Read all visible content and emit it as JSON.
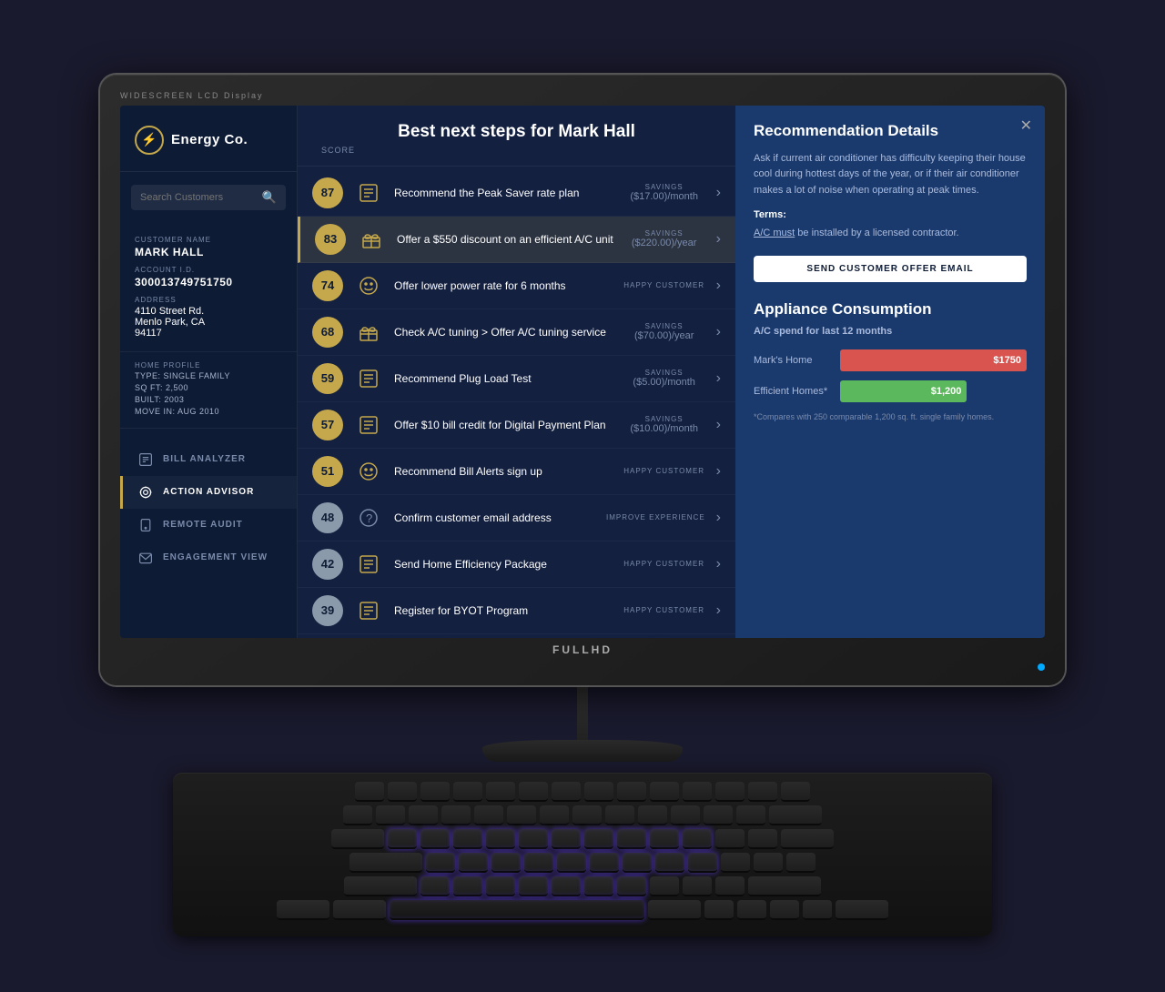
{
  "monitor": {
    "brand": "WIDESCREEN LCD Display",
    "fullhd": "FULLHD"
  },
  "app": {
    "logo": "⚡",
    "company": "Energy Co.",
    "search_placeholder": "Search Customers",
    "main_title": "Best next steps for Mark Hall",
    "score_label": "SCORE"
  },
  "customer": {
    "name_label": "CUSTOMER NAME",
    "name": "MARK HALL",
    "account_label": "ACCOUNT I.D.",
    "account": "300013749751750",
    "address_label": "ADDRESS",
    "address_line1": "4110 Street Rd.",
    "address_line2": "Menlo Park, CA",
    "address_line3": "94117",
    "profile_label": "HOME PROFILE",
    "type": "TYPE: SINGLE FAMILY",
    "sqft": "SQ FT: 2,500",
    "built": "BUILT: 2003",
    "movein": "MOVE IN: AUG 2010"
  },
  "nav": [
    {
      "id": "bill-analyzer",
      "label": "BILL ANALYZER",
      "icon": "grid"
    },
    {
      "id": "action-advisor",
      "label": "ACTION ADVISOR",
      "icon": "target",
      "active": true
    },
    {
      "id": "remote-audit",
      "label": "REMOTE AUDIT",
      "icon": "phone"
    },
    {
      "id": "engagement-view",
      "label": "ENGAGEMENT VIEW",
      "icon": "mail"
    }
  ],
  "actions": [
    {
      "score": 87,
      "text": "Recommend the Peak Saver rate plan",
      "tag_type": "savings",
      "tag_label": "SAVINGS",
      "tag_value": "($17.00)/month",
      "icon": "checklist"
    },
    {
      "score": 83,
      "text": "Offer a $550 discount on an efficient A/C unit",
      "tag_type": "savings",
      "tag_label": "SAVINGS",
      "tag_value": "($220.00)/year",
      "icon": "gift",
      "highlighted": true
    },
    {
      "score": 74,
      "text": "Offer lower power rate for 6 months",
      "tag_type": "happy",
      "tag_label": "HAPPY CUSTOMER",
      "tag_value": "",
      "icon": "smiley"
    },
    {
      "score": 68,
      "text": "Check A/C tuning > Offer A/C tuning service",
      "tag_type": "savings",
      "tag_label": "SAVINGS",
      "tag_value": "($70.00)/year",
      "icon": "gift"
    },
    {
      "score": 59,
      "text": "Recommend Plug Load Test",
      "tag_type": "savings",
      "tag_label": "SAVINGS",
      "tag_value": "($5.00)/month",
      "icon": "checklist"
    },
    {
      "score": 57,
      "text": "Offer $10 bill credit for Digital Payment Plan",
      "tag_type": "savings",
      "tag_label": "SAVINGS",
      "tag_value": "($10.00)/month",
      "icon": "checklist"
    },
    {
      "score": 51,
      "text": "Recommend Bill Alerts sign up",
      "tag_type": "happy",
      "tag_label": "HAPPY CUSTOMER",
      "tag_value": "",
      "icon": "smiley"
    },
    {
      "score": 48,
      "text": "Confirm customer email address",
      "tag_type": "improve",
      "tag_label": "IMPROVE EXPERIENCE",
      "tag_value": "",
      "icon": "question"
    },
    {
      "score": 42,
      "text": "Send Home Efficiency Package",
      "tag_type": "happy",
      "tag_label": "HAPPY CUSTOMER",
      "tag_value": "",
      "icon": "checklist"
    },
    {
      "score": 39,
      "text": "Register for BYOT Program",
      "tag_type": "happy",
      "tag_label": "HAPPY CUSTOMER",
      "tag_value": "",
      "icon": "checklist"
    }
  ],
  "recommendation": {
    "title": "Recommendation Details",
    "body": "Ask if current air conditioner has difficulty keeping their house cool during hottest days of the year, or if their air conditioner makes a lot of noise when operating at peak times.",
    "terms_label": "Terms:",
    "terms": "A/C must be installed by a licensed contractor.",
    "send_btn": "SEND CUSTOMER OFFER EMAIL",
    "appliance_title": "Appliance Consumption",
    "appliance_subtitle": "A/C spend for last 12 months",
    "bars": [
      {
        "label": "Mark's Home",
        "value": "$1750",
        "pct": 100,
        "color": "red"
      },
      {
        "label": "Efficient Homes*",
        "value": "$1,200",
        "pct": 68,
        "color": "green"
      }
    ],
    "note": "*Compares with 250 comparable 1,200 sq. ft. single family homes."
  }
}
